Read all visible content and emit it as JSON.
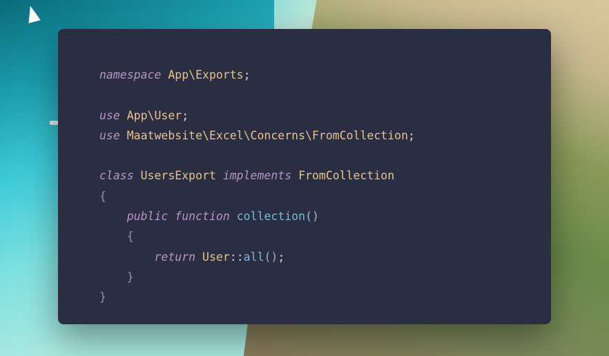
{
  "code": {
    "line1": {
      "kw": "namespace",
      "ns": " App\\Exports",
      "end": ";"
    },
    "line3": {
      "kw": "use",
      "ns": " App\\User",
      "end": ";"
    },
    "line4": {
      "kw": "use",
      "ns": " Maatwebsite\\Excel\\Concerns\\FromCollection",
      "end": ";"
    },
    "line6": {
      "kw1": "class",
      "name": " UsersExport ",
      "kw2": "implements",
      "impl": " FromCollection"
    },
    "line7": {
      "brace": "{"
    },
    "line8": {
      "indent": "    ",
      "kw1": "public",
      "sp": " ",
      "kw2": "function",
      "fn": " collection",
      "paren": "()"
    },
    "line9": {
      "indent": "    ",
      "brace": "{"
    },
    "line10": {
      "indent": "        ",
      "kw": "return",
      "cls": " User",
      "call": "::",
      "fn": "all",
      "paren": "()",
      "end": ";"
    },
    "line11": {
      "indent": "    ",
      "brace": "}"
    },
    "line12": {
      "brace": "}"
    }
  }
}
